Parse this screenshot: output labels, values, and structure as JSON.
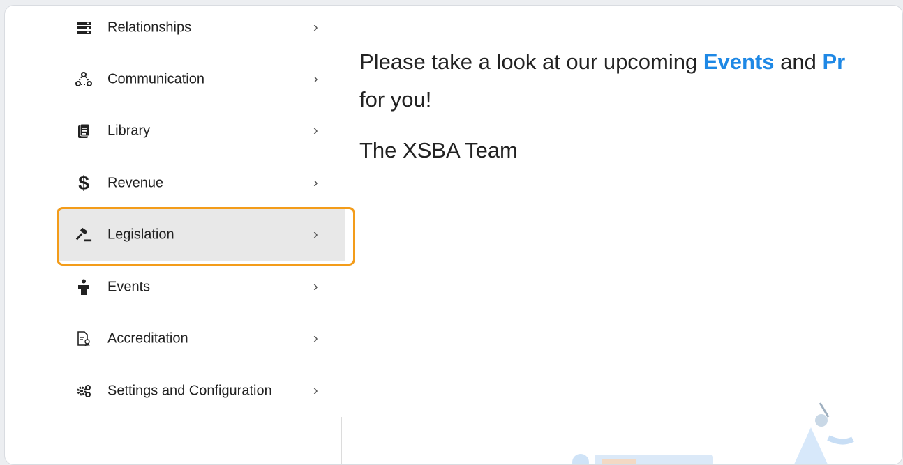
{
  "sidebar": {
    "items": [
      {
        "label": "Relationships",
        "icon": "relationships-icon",
        "chevron": "›"
      },
      {
        "label": "Communication",
        "icon": "communication-icon",
        "chevron": "›"
      },
      {
        "label": "Library",
        "icon": "library-icon",
        "chevron": "›"
      },
      {
        "label": "Revenue",
        "icon": "dollar-icon",
        "chevron": "›"
      },
      {
        "label": "Legislation",
        "icon": "gavel-icon",
        "chevron": "›",
        "active": true
      },
      {
        "label": "Events",
        "icon": "person-podium-icon",
        "chevron": "›"
      },
      {
        "label": "Accreditation",
        "icon": "accreditation-doc-icon",
        "chevron": "›"
      },
      {
        "label": "Settings and Configuration",
        "icon": "gears-icon",
        "chevron": "›"
      }
    ]
  },
  "main": {
    "message_line1_pre": "Please take a look at our upcoming ",
    "message_link_events": "Events",
    "message_mid": " and ",
    "message_link_programs": "Pr",
    "message_line2": "for you!",
    "signoff": "The XSBA Team"
  },
  "colors": {
    "accent": "#1e88e5",
    "highlight": "#f39c1a",
    "active_bg": "#e8e8e8"
  }
}
